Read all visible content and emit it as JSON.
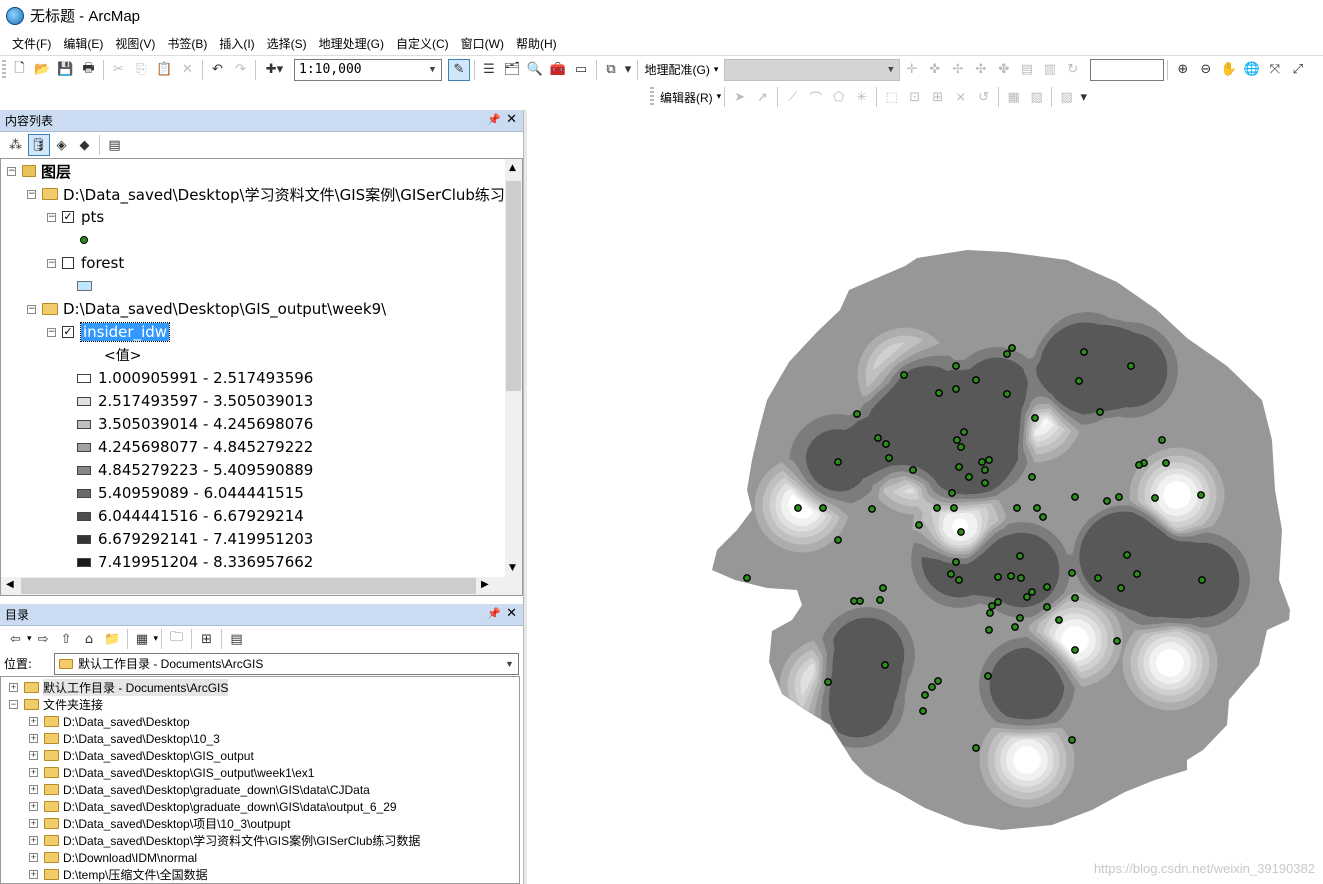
{
  "window": {
    "title": "无标题 - ArcMap"
  },
  "menu": [
    "文件(F)",
    "编辑(E)",
    "视图(V)",
    "书签(B)",
    "插入(I)",
    "选择(S)",
    "地理处理(G)",
    "自定义(C)",
    "窗口(W)",
    "帮助(H)"
  ],
  "toolbar": {
    "scale": "1:10,000",
    "georef_label": "地理配准(G)",
    "editor_label": "编辑器(R)"
  },
  "toc": {
    "title": "内容列表",
    "root": "图层",
    "group1": "D:\\Data_saved\\Desktop\\学习资料文件\\GIS案例\\GISerClub练习",
    "layer_pts": "pts",
    "layer_forest": "forest",
    "group2": "D:\\Data_saved\\Desktop\\GIS_output\\week9\\",
    "layer_idw": "insider_idw",
    "value_label": "<值>",
    "classes": [
      {
        "label": "1.000905991 - 2.517493596",
        "color": "#ffffff"
      },
      {
        "label": "2.517493597 - 3.505039013",
        "color": "#e0e0e0"
      },
      {
        "label": "3.505039014 - 4.245698076",
        "color": "#c0c0c0"
      },
      {
        "label": "4.245698077 - 4.845279222",
        "color": "#a2a2a2"
      },
      {
        "label": "4.845279223 - 5.409590889",
        "color": "#878787"
      },
      {
        "label": "5.40959089 - 6.044441515",
        "color": "#6b6b6b"
      },
      {
        "label": "6.044441516 - 6.67929214",
        "color": "#4f4f4f"
      },
      {
        "label": "6.679292141 - 7.419951203",
        "color": "#333333"
      },
      {
        "label": "7.419951204 - 8.336957662",
        "color": "#1a1a1a"
      }
    ]
  },
  "catalog": {
    "title": "目录",
    "location_label": "位置:",
    "location_value": "默认工作目录 - Documents\\ArcGIS",
    "home": "默认工作目录 - Documents\\ArcGIS",
    "folder_connections": "文件夹连接",
    "folders": [
      "D:\\Data_saved\\Desktop",
      "D:\\Data_saved\\Desktop\\10_3",
      "D:\\Data_saved\\Desktop\\GIS_output",
      "D:\\Data_saved\\Desktop\\GIS_output\\week1\\ex1",
      "D:\\Data_saved\\Desktop\\graduate_down\\GIS\\data\\CJData",
      "D:\\Data_saved\\Desktop\\graduate_down\\GIS\\data\\output_6_29",
      "D:\\Data_saved\\Desktop\\项目\\10_3\\outpupt",
      "D:\\Data_saved\\Desktop\\学习资料文件\\GIS案例\\GISerClub练习数据",
      "D:\\Download\\IDM\\normal",
      "D:\\temp\\压缩文件\\全国数据"
    ]
  },
  "watermark": "https://blog.csdn.net/weixin_39190382",
  "colors": {
    "panel_title": "#cbdcf2",
    "selection": "#3399ff",
    "point_fill": "#2e8b1e"
  }
}
